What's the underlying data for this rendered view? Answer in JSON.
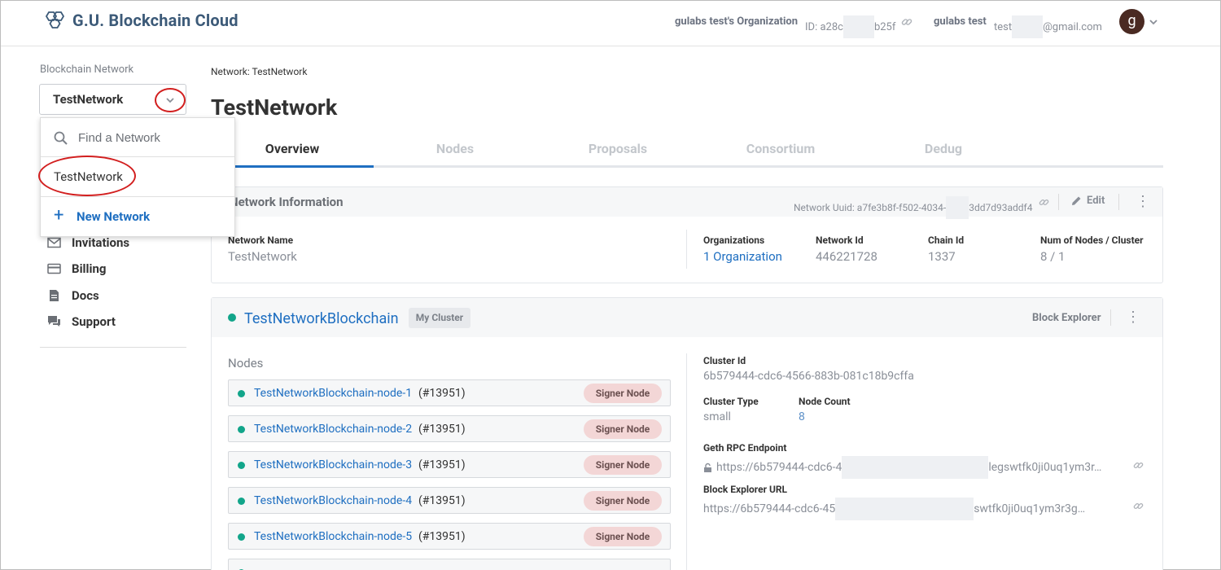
{
  "header": {
    "app_name": "G.U. Blockchain Cloud",
    "org_name": "gulabs test's Organization",
    "org_id_prefix": "ID: a28c",
    "org_id_suffix": "b25f",
    "user_name": "gulabs test",
    "email_prefix": "test",
    "email_suffix": "@gmail.com",
    "avatar_letter": "g"
  },
  "sidebar": {
    "label": "Blockchain Network",
    "selected_network": "TestNetwork",
    "dropdown": {
      "search_placeholder": "Find a Network",
      "items": [
        "TestNetwork"
      ],
      "new_label": "New Network"
    },
    "nav": [
      {
        "label": "Invitations",
        "icon": "mail-icon"
      },
      {
        "label": "Billing",
        "icon": "credit-card-icon"
      },
      {
        "label": "Docs",
        "icon": "document-icon"
      },
      {
        "label": "Support",
        "icon": "chat-icon"
      }
    ]
  },
  "main": {
    "breadcrumb": "Network: TestNetwork",
    "title": "TestNetwork",
    "tabs": [
      {
        "label": "Overview",
        "active": true
      },
      {
        "label": "Nodes",
        "active": false
      },
      {
        "label": "Proposals",
        "active": false
      },
      {
        "label": "Consortium",
        "active": false
      },
      {
        "label": "Dedug",
        "active": false
      }
    ]
  },
  "network_info": {
    "title": "Network Information",
    "uuid_prefix": "Network Uuid: a7fe3b8f-f502-4034-",
    "uuid_suffix": "3dd7d93addf4",
    "edit_label": "Edit",
    "network_name_label": "Network Name",
    "network_name": "TestNetwork",
    "organizations_label": "Organizations",
    "organizations": "1 Organization",
    "network_id_label": "Network Id",
    "network_id": "446221728",
    "chain_id_label": "Chain Id",
    "chain_id": "1337",
    "num_nodes_label": "Num of Nodes / Cluster",
    "num_nodes": "8 / 1"
  },
  "cluster": {
    "name": "TestNetworkBlockchain",
    "badge": "My Cluster",
    "block_explorer_label": "Block Explorer",
    "nodes_label": "Nodes",
    "nodes": [
      {
        "name": "TestNetworkBlockchain-node-1",
        "id": "(#13951)",
        "role": "Signer Node"
      },
      {
        "name": "TestNetworkBlockchain-node-2",
        "id": "(#13951)",
        "role": "Signer Node"
      },
      {
        "name": "TestNetworkBlockchain-node-3",
        "id": "(#13951)",
        "role": "Signer Node"
      },
      {
        "name": "TestNetworkBlockchain-node-4",
        "id": "(#13951)",
        "role": "Signer Node"
      },
      {
        "name": "TestNetworkBlockchain-node-5",
        "id": "(#13951)",
        "role": "Signer Node"
      }
    ],
    "cluster_id_label": "Cluster Id",
    "cluster_id": "6b579444-cdc6-4566-883b-081c18b9cffa",
    "cluster_type_label": "Cluster Type",
    "cluster_type": "small",
    "node_count_label": "Node Count",
    "node_count": "8",
    "geth_label": "Geth RPC Endpoint",
    "geth_prefix": "https://6b579444-cdc6-4",
    "geth_suffix": "legswtfk0ji0uq1ym3r…",
    "explorer_url_label": "Block Explorer URL",
    "explorer_prefix": "https://6b579444-cdc6-45",
    "explorer_suffix": "swtfk0ji0uq1ym3r3g…"
  },
  "colors": {
    "accent": "#1f6fc1",
    "status_green": "#12a58a",
    "highlight_red": "#d21f1f"
  }
}
